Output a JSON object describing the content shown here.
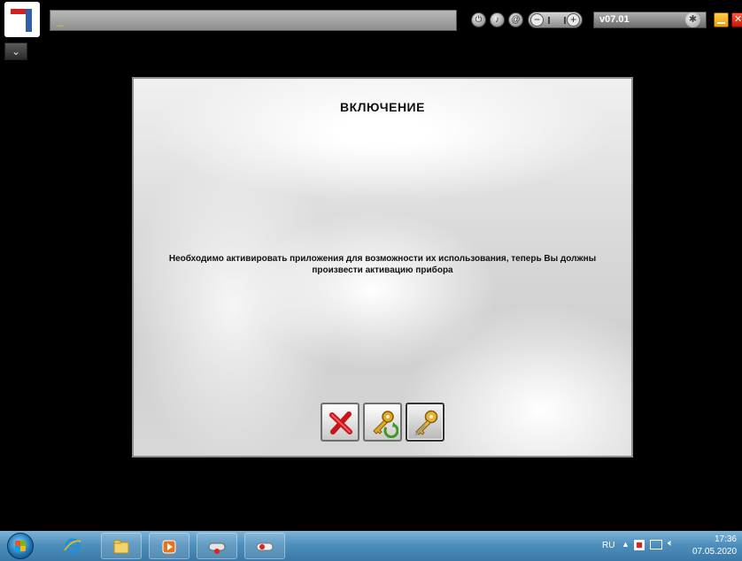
{
  "topbar": {
    "title_field_text": "_",
    "version": "v07.01",
    "icons": [
      "power-icon",
      "volume-icon",
      "settings-icon",
      "volume-control",
      "gear-icon",
      "minimize-icon",
      "close-icon"
    ]
  },
  "expand_glyph": "⌄",
  "dialog": {
    "title": "ВКЛЮЧЕНИЕ",
    "message": "Необходимо активировать приложения для возможности их использования, теперь Вы должны произвести активацию прибора",
    "buttons": [
      {
        "name": "cancel",
        "icon": "red-x-icon"
      },
      {
        "name": "activate-online",
        "icon": "key-refresh-icon"
      },
      {
        "name": "activate-key",
        "icon": "key-icon"
      }
    ]
  },
  "taskbar": {
    "pinned": [
      "start-button",
      "internet-explorer",
      "file-explorer",
      "media-player",
      "diagnostic-app",
      "toggle-app"
    ],
    "tray": {
      "language": "RU",
      "time": "17:36",
      "date": "07.05.2020"
    }
  },
  "colors": {
    "background": "#000000",
    "dialog_border": "#8f8f8f",
    "taskbar": "#4f8fbc",
    "accent_red": "#d3201f",
    "accent_orange": "#f09a0b"
  }
}
